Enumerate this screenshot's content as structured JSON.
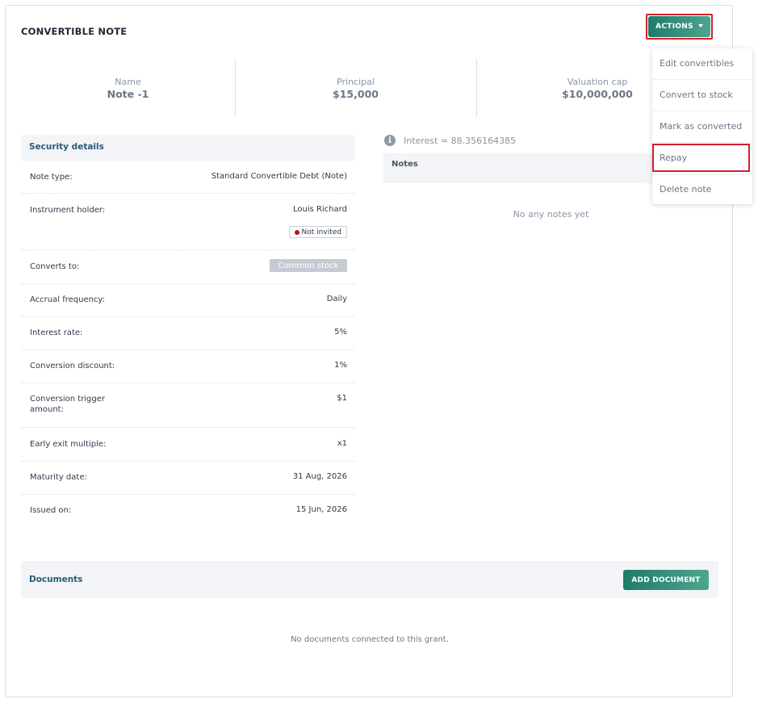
{
  "header": {
    "title": "CONVERTIBLE NOTE",
    "actions_label": "ACTIONS"
  },
  "stats": [
    {
      "label": "Name",
      "value": "Note -1"
    },
    {
      "label": "Principal",
      "value": "$15,000"
    },
    {
      "label": "Valuation cap",
      "value": "$10,000,000"
    }
  ],
  "security": {
    "title": "Security details",
    "rows": [
      {
        "key": "Note type:",
        "value": "Standard Convertible Debt (Note)"
      },
      {
        "key": "Instrument holder:",
        "value": "Louis Richard",
        "badge": "Not invited"
      },
      {
        "key": "Converts to:",
        "value": "Common stock"
      },
      {
        "key": "Accrual frequency:",
        "value": "Daily"
      },
      {
        "key": "Interest rate:",
        "value": "5%"
      },
      {
        "key": "Conversion discount:",
        "value": "1%"
      },
      {
        "key": "Conversion trigger amount:",
        "value": "$1"
      },
      {
        "key": "Early exit multiple:",
        "value": "x1"
      },
      {
        "key": "Maturity date:",
        "value": "31 Aug, 2026"
      },
      {
        "key": "Issued on:",
        "value": "15 Jun, 2026"
      }
    ]
  },
  "interest": {
    "text": "Interest = 88.356164385"
  },
  "notes": {
    "title": "Notes",
    "empty": "No any notes yet"
  },
  "documents": {
    "title": "Documents",
    "add_label": "ADD DOCUMENT",
    "empty": "No documents connected to this grant."
  },
  "actions_menu": {
    "items": [
      "Edit convertibles",
      "Convert to stock",
      "Mark as converted",
      "Repay",
      "Delete note"
    ]
  },
  "colors": {
    "accent": "#1d7c6a",
    "highlight": "#d0202a",
    "section_title": "#2a5a7a"
  }
}
